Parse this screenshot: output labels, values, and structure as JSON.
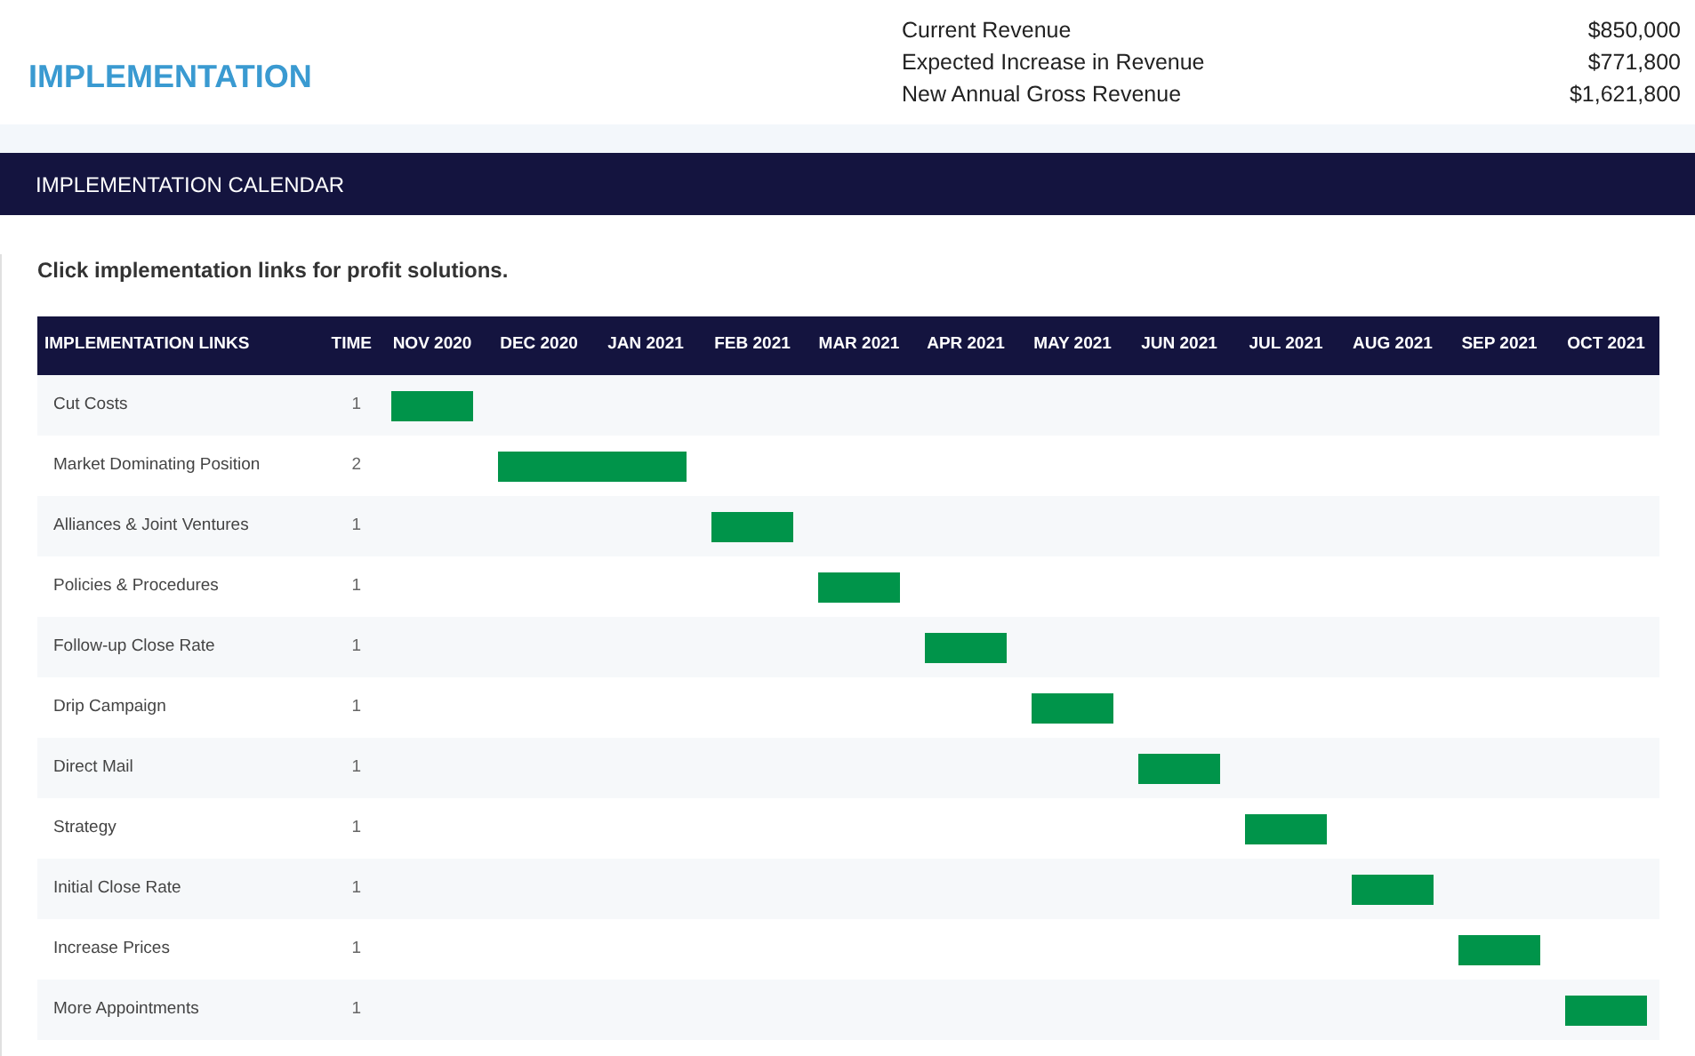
{
  "page_title": "IMPLEMENTATION",
  "revenue": [
    {
      "label": "Current Revenue",
      "value": "$850,000"
    },
    {
      "label": "Expected Increase in Revenue",
      "value": "$771,800"
    },
    {
      "label": "New Annual Gross Revenue",
      "value": "$1,621,800"
    }
  ],
  "section_title": "IMPLEMENTATION CALENDAR",
  "instruction": "Click implementation links for profit solutions.",
  "table": {
    "columns": [
      "IMPLEMENTATION LINKS",
      "TIME",
      "NOV 2020",
      "DEC 2020",
      "JAN 2021",
      "FEB 2021",
      "MAR 2021",
      "APR 2021",
      "MAY 2021",
      "JUN 2021",
      "JUL 2021",
      "AUG 2021",
      "SEP 2021",
      "OCT 2021"
    ],
    "rows": [
      {
        "name": "Cut Costs",
        "time": "1",
        "scheduled": [
          true,
          false,
          false,
          false,
          false,
          false,
          false,
          false,
          false,
          false,
          false,
          false
        ]
      },
      {
        "name": "Market Dominating Position",
        "time": "2",
        "scheduled": [
          false,
          true,
          true,
          false,
          false,
          false,
          false,
          false,
          false,
          false,
          false,
          false
        ]
      },
      {
        "name": "Alliances & Joint Ventures",
        "time": "1",
        "scheduled": [
          false,
          false,
          false,
          true,
          false,
          false,
          false,
          false,
          false,
          false,
          false,
          false
        ]
      },
      {
        "name": "Policies & Procedures",
        "time": "1",
        "scheduled": [
          false,
          false,
          false,
          false,
          true,
          false,
          false,
          false,
          false,
          false,
          false,
          false
        ]
      },
      {
        "name": "Follow-up Close Rate",
        "time": "1",
        "scheduled": [
          false,
          false,
          false,
          false,
          false,
          true,
          false,
          false,
          false,
          false,
          false,
          false
        ]
      },
      {
        "name": "Drip Campaign",
        "time": "1",
        "scheduled": [
          false,
          false,
          false,
          false,
          false,
          false,
          true,
          false,
          false,
          false,
          false,
          false
        ]
      },
      {
        "name": "Direct Mail",
        "time": "1",
        "scheduled": [
          false,
          false,
          false,
          false,
          false,
          false,
          false,
          true,
          false,
          false,
          false,
          false
        ]
      },
      {
        "name": "Strategy",
        "time": "1",
        "scheduled": [
          false,
          false,
          false,
          false,
          false,
          false,
          false,
          false,
          true,
          false,
          false,
          false
        ]
      },
      {
        "name": "Initial Close Rate",
        "time": "1",
        "scheduled": [
          false,
          false,
          false,
          false,
          false,
          false,
          false,
          false,
          false,
          true,
          false,
          false
        ]
      },
      {
        "name": "Increase Prices",
        "time": "1",
        "scheduled": [
          false,
          false,
          false,
          false,
          false,
          false,
          false,
          false,
          false,
          false,
          true,
          false
        ]
      },
      {
        "name": "More Appointments",
        "time": "1",
        "scheduled": [
          false,
          false,
          false,
          false,
          false,
          false,
          false,
          false,
          false,
          false,
          false,
          true
        ]
      }
    ]
  }
}
